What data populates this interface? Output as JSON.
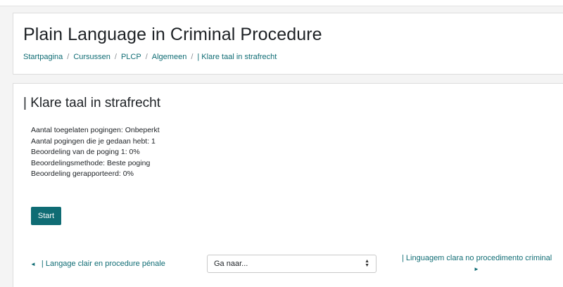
{
  "header": {
    "course_title": "Plain Language in Criminal Procedure",
    "breadcrumb": [
      {
        "label": "Startpagina"
      },
      {
        "label": "Cursussen"
      },
      {
        "label": "PLCP"
      },
      {
        "label": "Algemeen"
      },
      {
        "label": "| Klare taal in strafrecht"
      }
    ],
    "separator": "/"
  },
  "quiz": {
    "title": "| Klare taal in strafrecht",
    "info_lines": [
      "Aantal toegelaten pogingen: Onbeperkt",
      "Aantal pogingen die je gedaan hebt: 1",
      "Beoordeling van de poging 1: 0%",
      "Beoordelingsmethode: Beste poging",
      "Beoordeling gerapporteerd: 0%"
    ],
    "start_label": "Start"
  },
  "navigation": {
    "prev_label": "| Langage clair en procedure pénale",
    "prev_arrow": "◄",
    "goto_value": "Ga naar...",
    "next_label": "| Linguagem clara no procedimento criminal",
    "next_arrow": "►"
  },
  "colors": {
    "accent": "#0f6c74",
    "page_background": "#f4f4f4",
    "card_background": "#ffffff"
  },
  "icons": {
    "prev": "triangle-left-icon",
    "next": "triangle-right-icon",
    "select": "updown-chevron-icon"
  }
}
